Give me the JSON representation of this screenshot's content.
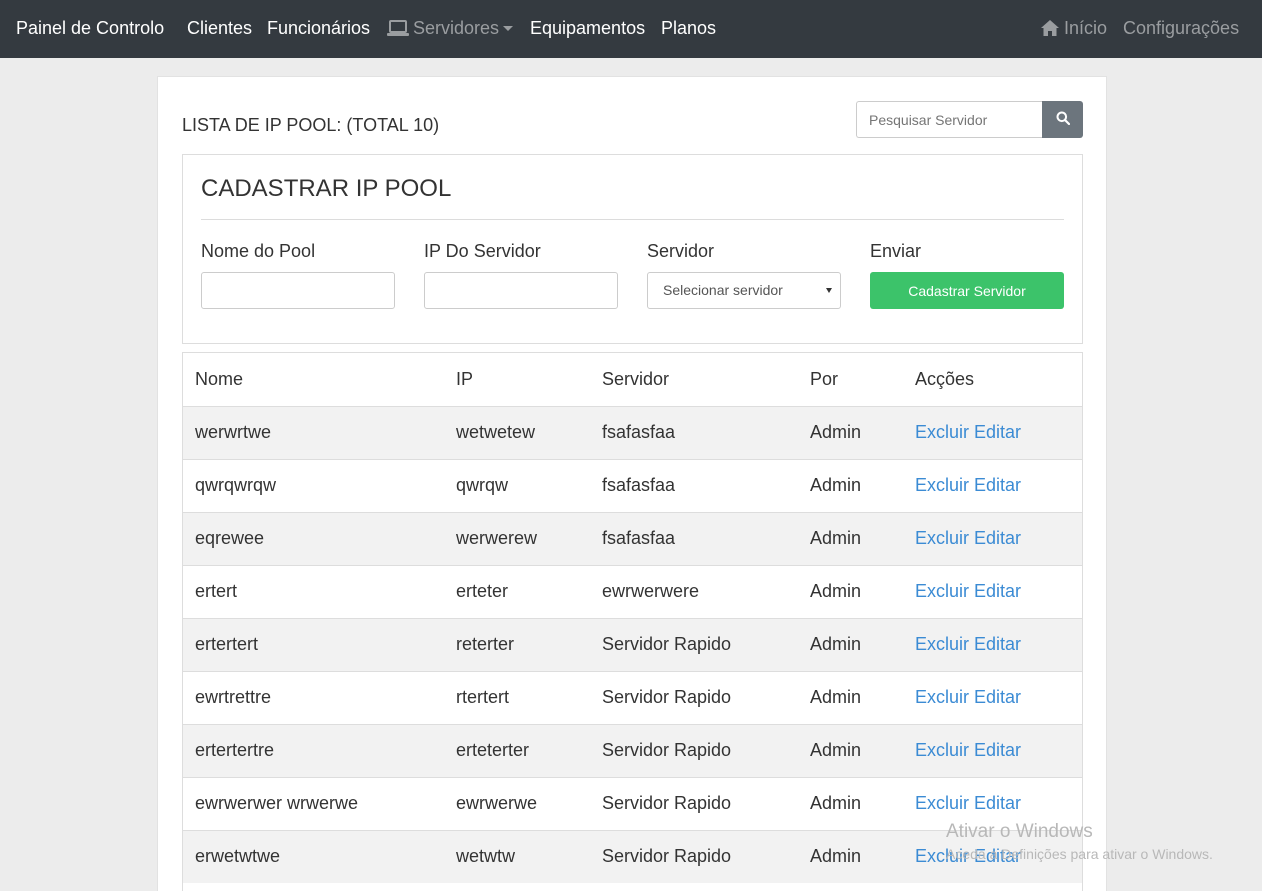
{
  "navbar": {
    "brand": "Painel de Controlo",
    "items": [
      {
        "label": "Clientes"
      },
      {
        "label": "Funcionários"
      },
      {
        "label": "Servidores",
        "icon": "laptop-icon"
      },
      {
        "label": "Equipamentos"
      },
      {
        "label": "Planos"
      }
    ],
    "right_items": [
      {
        "label": "Início",
        "icon": "home-icon"
      },
      {
        "label": "Configurações"
      }
    ]
  },
  "header": {
    "list_title": "LISTA DE IP POOL: (TOTAL 10)",
    "search_placeholder": "Pesquisar Servidor"
  },
  "form": {
    "title": "CADASTRAR IP POOL",
    "fields": [
      {
        "label": "Nome do Pool",
        "value": ""
      },
      {
        "label": "IP Do Servidor",
        "value": ""
      },
      {
        "label": "Servidor",
        "selected": "Selecionar servidor"
      },
      {
        "label": "Enviar"
      }
    ],
    "submit_label": "Cadastrar Servidor"
  },
  "table": {
    "headers": [
      "Nome",
      "IP",
      "Servidor",
      "Por",
      "Acções"
    ],
    "action_labels": {
      "delete": "Excluir",
      "edit": "Editar"
    },
    "rows": [
      {
        "nome": "werwrtwe",
        "ip": "wetwetew",
        "servidor": "fsafasfaa",
        "por": "Admin"
      },
      {
        "nome": "qwrqwrqw",
        "ip": "qwrqw",
        "servidor": "fsafasfaa",
        "por": "Admin"
      },
      {
        "nome": "eqrewee",
        "ip": "werwerew",
        "servidor": "fsafasfaa",
        "por": "Admin"
      },
      {
        "nome": "ertert",
        "ip": "erteter",
        "servidor": "ewrwerwere",
        "por": "Admin"
      },
      {
        "nome": "ertertert",
        "ip": "reterter",
        "servidor": "Servidor Rapido",
        "por": "Admin"
      },
      {
        "nome": "ewrtrettre",
        "ip": "rtertert",
        "servidor": "Servidor Rapido",
        "por": "Admin"
      },
      {
        "nome": "ertertertre",
        "ip": "erteterter",
        "servidor": "Servidor Rapido",
        "por": "Admin"
      },
      {
        "nome": "ewrwerwer wrwerwe",
        "ip": "ewrwerwe",
        "servidor": "Servidor Rapido",
        "por": "Admin"
      },
      {
        "nome": "erwetwtwe",
        "ip": "wetwtw",
        "servidor": "Servidor Rapido",
        "por": "Admin"
      }
    ]
  },
  "watermark": {
    "line1": "Ativar o Windows",
    "line2": "Aceda a Definições para ativar o Windows."
  }
}
